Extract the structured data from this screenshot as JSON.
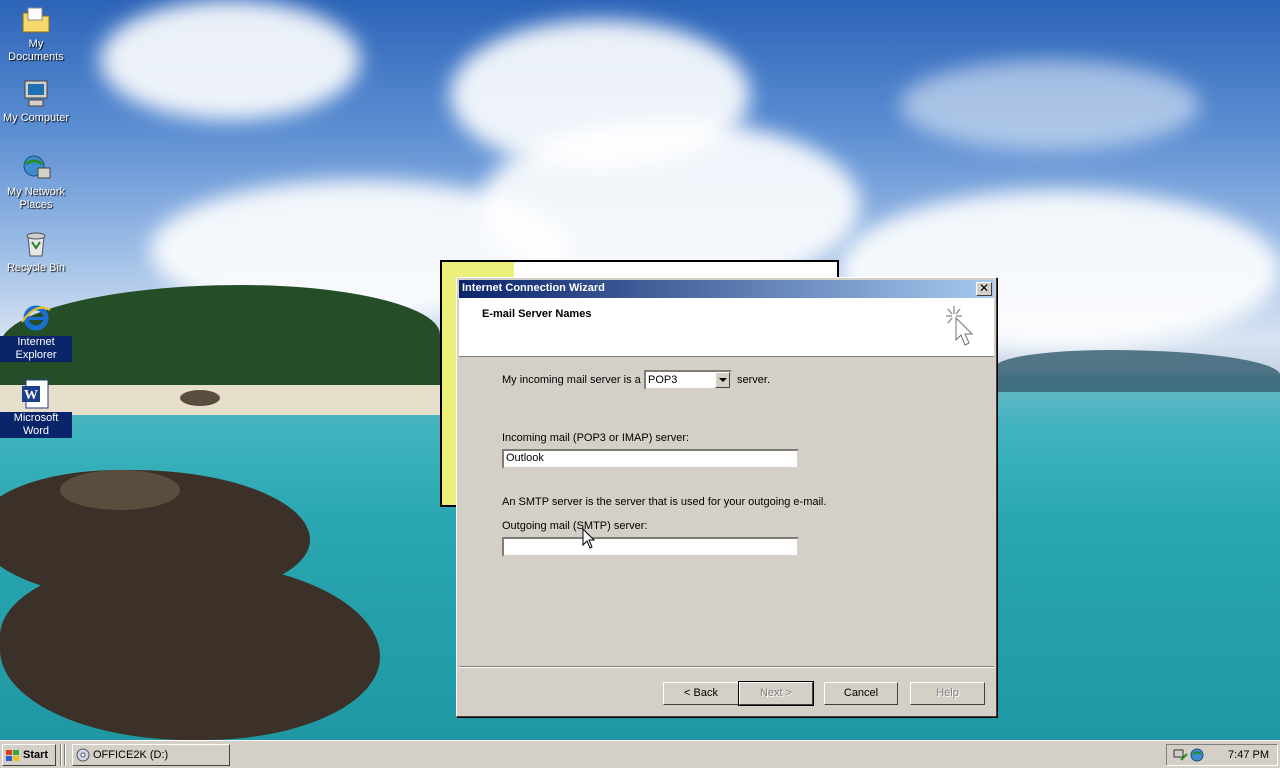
{
  "desktop": {
    "icons": [
      {
        "label": "My Documents",
        "icon": "folder-documents-icon"
      },
      {
        "label": "My Computer",
        "icon": "computer-icon"
      },
      {
        "label": "My Network Places",
        "icon": "network-icon"
      },
      {
        "label": "Recycle Bin",
        "icon": "recycle-bin-icon"
      },
      {
        "label": "Internet Explorer",
        "icon": "internet-explorer-icon"
      },
      {
        "label": "Microsoft Word",
        "icon": "word-icon"
      }
    ]
  },
  "dialog": {
    "title": "Internet Connection Wizard",
    "header_title": "E-mail Server Names",
    "incoming_prefix": "My incoming mail server is a",
    "incoming_type": "POP3",
    "incoming_suffix": "server.",
    "incoming_label": "Incoming mail (POP3 or IMAP) server:",
    "incoming_value": "Outlook",
    "smtp_note": "An SMTP server is the server that is used for your outgoing e-mail.",
    "outgoing_label": "Outgoing mail (SMTP) server:",
    "outgoing_value": "",
    "buttons": {
      "back": "< Back",
      "next": "Next >",
      "cancel": "Cancel",
      "help": "Help"
    },
    "close_glyph": "✕"
  },
  "taskbar": {
    "start_label": "Start",
    "task_label": "OFFICE2K (D:)",
    "clock": "7:47 PM"
  },
  "colors": {
    "titlebar_start": "#0a246a",
    "titlebar_end": "#a6caf0",
    "face": "#d4d0c8"
  }
}
